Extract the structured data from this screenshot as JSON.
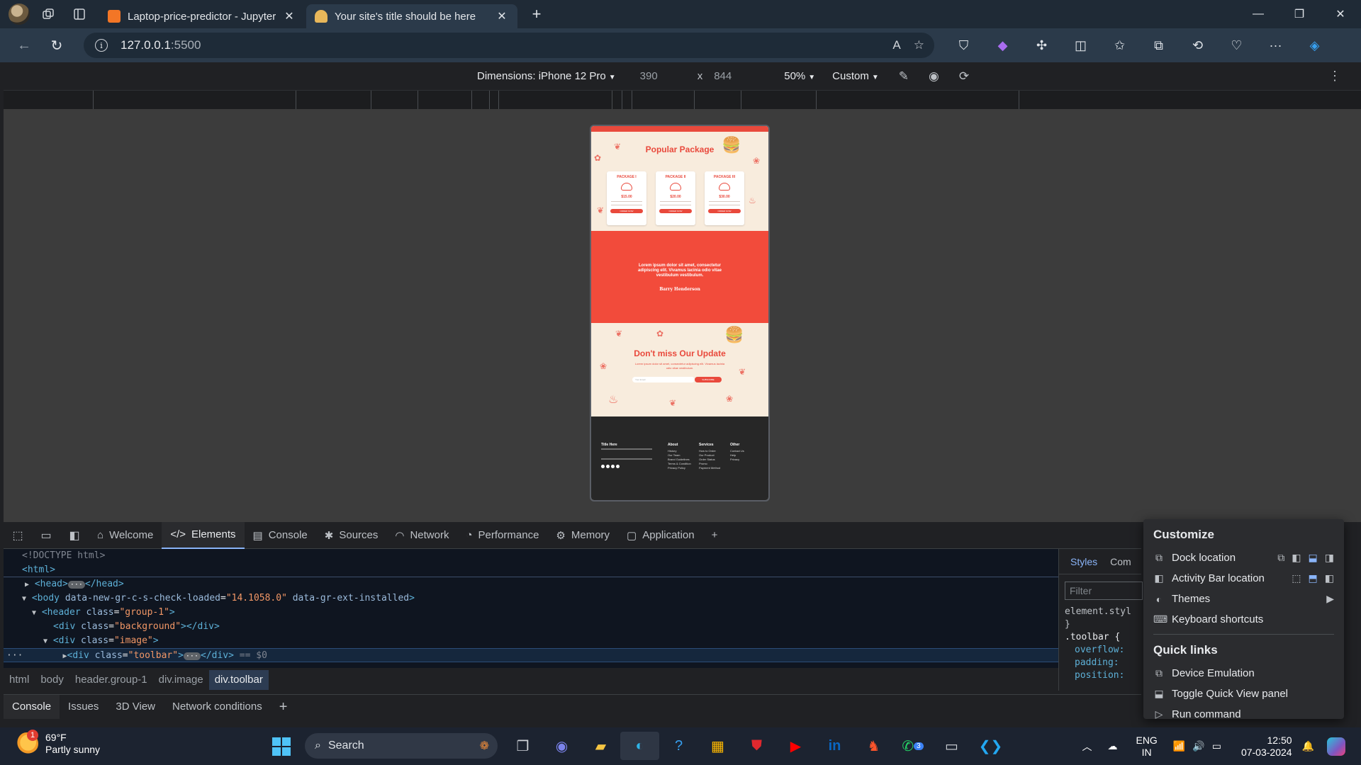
{
  "tabs": [
    {
      "title": "Laptop-price-predictor - Jupyter",
      "active": false
    },
    {
      "title": "Your site's title should be here",
      "active": true
    }
  ],
  "address": {
    "host": "127.0.0.1",
    "port": ":5500"
  },
  "device_toolbar": {
    "dimensions_label": "Dimensions: iPhone 12 Pro",
    "width": "390",
    "times": "x",
    "height": "844",
    "zoom": "50%",
    "throttle": "Custom"
  },
  "page": {
    "popular_title": "Popular Package",
    "packages": [
      {
        "name": "PACKAGE I",
        "price": "$15.00",
        "button": "ORDER NOW"
      },
      {
        "name": "PACKAGE II",
        "price": "$20.00",
        "button": "ORDER NOW"
      },
      {
        "name": "PACKAGE III",
        "price": "$30.00",
        "button": "ORDER NOW"
      }
    ],
    "testimonial_quote": "Lorem ipsum dolor sit amet, consectetur adipiscing elit. Vivamus lacinia odio vitae vestibulum vestibulum.",
    "testimonial_author": "Barry Henderson",
    "update_title": "Don't miss Our Update",
    "update_sub": "Lorem ipsum dolor sit amet, consectetur adipiscing elit. Vivamus lacinia odio vitae vestibulum.",
    "email_placeholder": "Your Email",
    "subscribe_button": "SUBSCRIBE",
    "footer": {
      "brand": "Title Here",
      "columns": [
        {
          "heading": "About",
          "items": [
            "History",
            "Our Team",
            "Brand Guidelines",
            "Terms & Condition",
            "Privacy Policy"
          ]
        },
        {
          "heading": "Services",
          "items": [
            "How to Order",
            "Our Product",
            "Order Status",
            "Promo",
            "Payment Method"
          ]
        },
        {
          "heading": "Other",
          "items": [
            "Contact Us",
            "Help",
            "Privacy"
          ]
        }
      ]
    }
  },
  "devtools": {
    "tabs": [
      "Welcome",
      "Elements",
      "Console",
      "Sources",
      "Network",
      "Performance",
      "Memory",
      "Application"
    ],
    "dom_lines": [
      "<!DOCTYPE html>",
      "<html>",
      "<head>",
      "</head>",
      "<body",
      "data-new-gr-c-s-check-loaded",
      "\"14.1058.0\"",
      "data-gr-ext-installed",
      "<header",
      "class",
      "\"group-1\"",
      "<div",
      "\"background\"",
      "</div>",
      "\"image\"",
      "\"toolbar\"",
      "== $0"
    ],
    "breadcrumbs": [
      "html",
      "body",
      "header.group-1",
      "div.image",
      "div.toolbar"
    ],
    "styles_tabs": [
      "Styles",
      "Com"
    ],
    "filter_placeholder": "Filter",
    "css_lines": [
      "element.styl",
      "}",
      ".toolbar {",
      "overflow:",
      "padding:",
      "position:"
    ],
    "drawer_tabs": [
      "Console",
      "Issues",
      "3D View",
      "Network conditions"
    ]
  },
  "customize_menu": {
    "header": "Customize",
    "items": [
      "Dock location",
      "Activity Bar location",
      "Themes",
      "Keyboard shortcuts"
    ],
    "quick_links_header": "Quick links",
    "quick_links": [
      "Device Emulation",
      "Toggle Quick View panel",
      "Run command"
    ]
  },
  "taskbar": {
    "weather_temp": "69°F",
    "weather_desc": "Partly sunny",
    "weather_badge": "1",
    "search": "Search",
    "whatsapp_badge": "3",
    "lang_top": "ENG",
    "lang_bottom": "IN",
    "time": "12:50",
    "date": "07-03-2024"
  }
}
